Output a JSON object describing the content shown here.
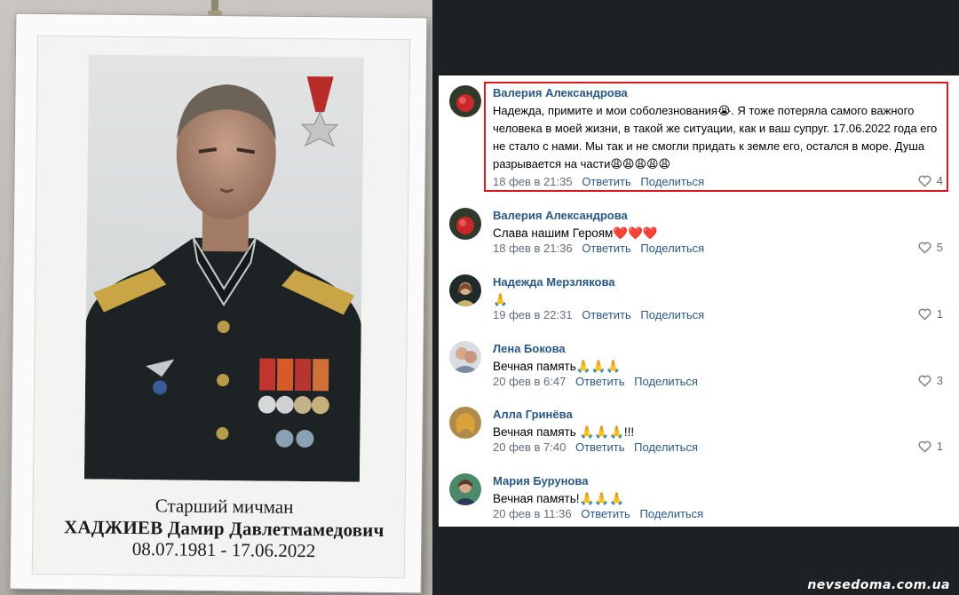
{
  "photo": {
    "rank": "Старший мичман",
    "name": "ХАДЖИЕВ Дамир Давлетмамедович",
    "dates": "08.07.1981 - 17.06.2022"
  },
  "actions": {
    "reply": "Ответить",
    "share": "Поделиться"
  },
  "comments": [
    {
      "author": "Валерия Александрова",
      "text": "Надежда, примите и мои соболезнования😭. Я тоже потеряла самого важного человека в моей жизни, в такой же ситуации, как и ваш супруг. 17.06.2022 года его не стало с нами. Мы так и не смогли придать к земле его, остался в море. Душа разрывается на части😩😩😩😩😩",
      "date": "18 фев в 21:35",
      "likes": "4",
      "highlighted": true
    },
    {
      "author": "Валерия Александрова",
      "text": "Слава нашим Героям❤️❤️❤️",
      "date": "18 фев в 21:36",
      "likes": "5"
    },
    {
      "author": "Надежда Мерзлякова",
      "text": "🙏",
      "date": "19 фев в 22:31",
      "likes": "1"
    },
    {
      "author": "Лена Бокова",
      "text": "Вечная память🙏🙏🙏",
      "date": "20 фев в 6:47",
      "likes": "3"
    },
    {
      "author": "Алла Гринёва",
      "text": "Вечная память 🙏🙏🙏!!!",
      "date": "20 фев в 7:40",
      "likes": "1"
    },
    {
      "author": "Мария Бурунова",
      "text": "Вечная память!🙏🙏🙏",
      "date": "20 фев в 11:36",
      "likes": ""
    }
  ],
  "icons": {
    "like": "heart-outline-icon"
  },
  "colors": {
    "link": "#2a5885",
    "highlight": "#e0171f",
    "meta": "#828282"
  },
  "watermark": "nevsedoma.com.ua"
}
